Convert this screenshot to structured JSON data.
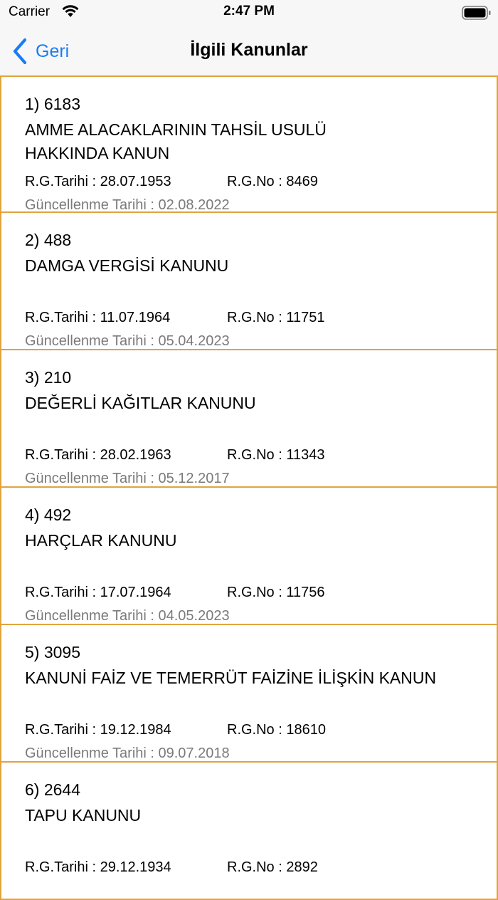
{
  "status_bar": {
    "carrier": "Carrier",
    "time": "2:47 PM",
    "icons": [
      "wifi-icon",
      "battery-icon"
    ]
  },
  "nav_bar": {
    "back_label": "Geri",
    "title": "İlgili Kanunlar",
    "accent_color": "#1a7cf5",
    "icons": [
      "chevron-left-icon"
    ]
  },
  "theme": {
    "item_border_color": "#e2a33d",
    "secondary_text_color": "#7a7a7a"
  },
  "laws": [
    {
      "number": "1) 6183",
      "title": "AMME ALACAKLARININ TAHSİL USULÜ HAKKINDA KANUN",
      "rg_date": "R.G.Tarihi : 28.07.1953",
      "rg_no": "R.G.No : 8469",
      "updated": "Güncellenme Tarihi : 02.08.2022"
    },
    {
      "number": "2) 488",
      "title": "DAMGA VERGİSİ KANUNU",
      "rg_date": "R.G.Tarihi : 11.07.1964",
      "rg_no": "R.G.No : 11751",
      "updated": "Güncellenme Tarihi : 05.04.2023"
    },
    {
      "number": "3) 210",
      "title": "DEĞERLİ KAĞITLAR KANUNU",
      "rg_date": "R.G.Tarihi : 28.02.1963",
      "rg_no": "R.G.No : 11343",
      "updated": "Güncellenme Tarihi : 05.12.2017"
    },
    {
      "number": "4) 492",
      "title": "HARÇLAR KANUNU",
      "rg_date": "R.G.Tarihi : 17.07.1964",
      "rg_no": "R.G.No : 11756",
      "updated": "Güncellenme Tarihi : 04.05.2023"
    },
    {
      "number": "5) 3095",
      "title": "KANUNİ FAİZ VE TEMERRÜT FAİZİNE İLİŞKİN KANUN",
      "rg_date": "R.G.Tarihi : 19.12.1984",
      "rg_no": "R.G.No : 18610",
      "updated": "Güncellenme Tarihi : 09.07.2018"
    },
    {
      "number": "6) 2644",
      "title": "TAPU KANUNU",
      "rg_date": "R.G.Tarihi : 29.12.1934",
      "rg_no": "R.G.No : 2892",
      "updated": ""
    }
  ]
}
